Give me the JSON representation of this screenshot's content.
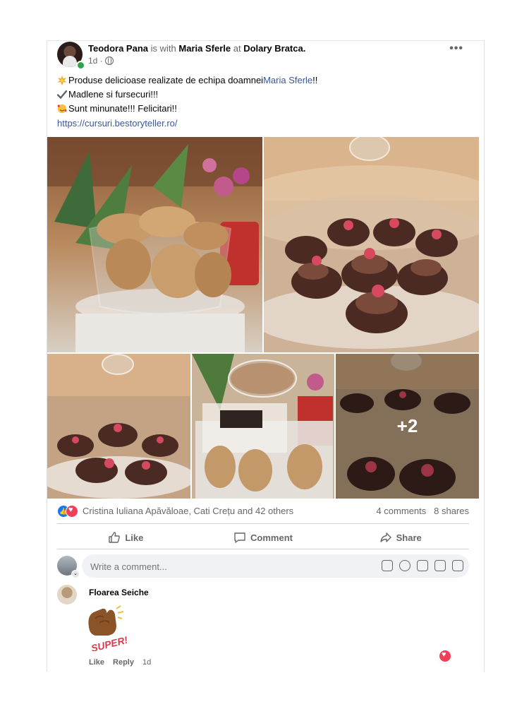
{
  "post": {
    "author": "Teodora Pana",
    "with_text": "is with",
    "tagged": "Maria Sferle",
    "at_text": "at",
    "place": "Dolary Bratca.",
    "time": "1d ·",
    "lines": [
      {
        "emoji": "collision",
        "before": "Produse delicioase realizate de echipa doamnei ",
        "link": "Maria Sferle",
        "after": "!!"
      },
      {
        "emoji": "check-mark",
        "before": "Madlene si fursecuri!!!",
        "link": "",
        "after": ""
      },
      {
        "emoji": "smiling-face-with-hearts",
        "before": "Sunt minunate!!! Felicitari!!",
        "link": "",
        "after": ""
      }
    ],
    "url": "https://cursuri.bestoryteller.ro/",
    "more_photos": "+2"
  },
  "reactions": {
    "names": "Cristina Iuliana Apăvăloae, Cati Crețu and 42 others",
    "comments": "4 comments",
    "shares": "8 shares"
  },
  "actions": {
    "like": "Like",
    "comment": "Comment",
    "share": "Share"
  },
  "composer": {
    "placeholder": "Write a comment..."
  },
  "comment": {
    "author": "Floarea Seiche",
    "sticker_text": "SUPER!",
    "like": "Like",
    "reply": "Reply",
    "time": "1d"
  },
  "colors": {
    "link": "#385898",
    "muted": "#65676b",
    "like_blue": "#1877f2",
    "love_red": "#f33e58"
  }
}
